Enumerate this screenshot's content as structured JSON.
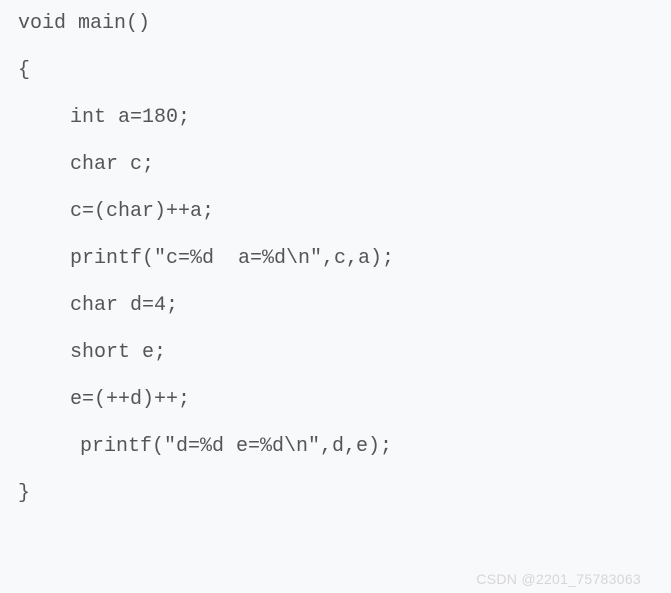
{
  "code": {
    "l1": "void main()",
    "l2": "{",
    "l3": "int a=180;",
    "l4": "char c;",
    "l5": "c=(char)++a;",
    "l6": "printf(\"c=%d  a=%d\\n\",c,a);",
    "l7": "char d=4;",
    "l8": "short e;",
    "l9": "e=(++d)++;",
    "l10": "printf(\"d=%d e=%d\\n\",d,e);",
    "l11": "}"
  },
  "watermark": "CSDN @2201_75783063"
}
